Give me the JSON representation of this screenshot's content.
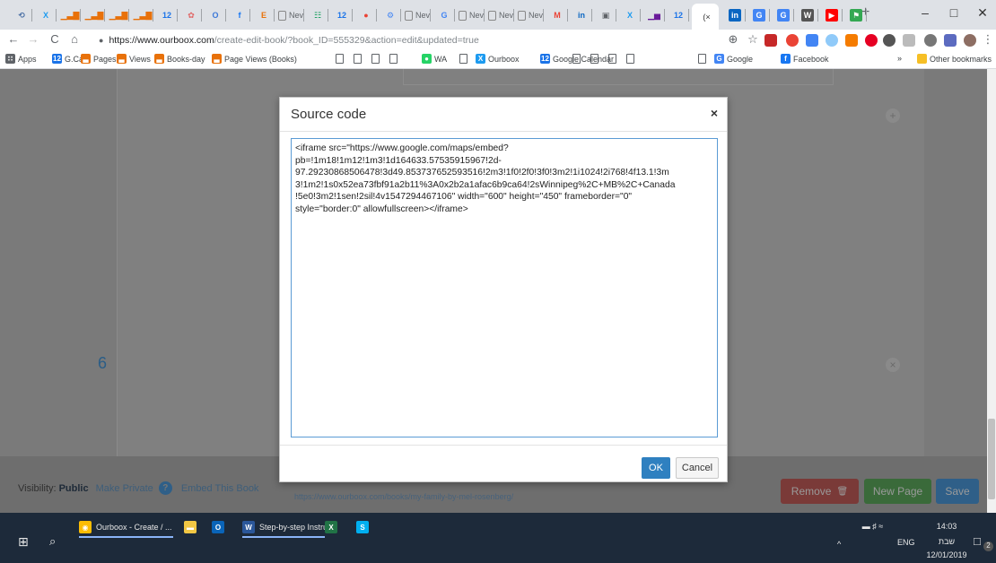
{
  "browser": {
    "tabs": [
      {
        "icon": "refresh-tab-icon",
        "glyph": "⟲",
        "color": "#4a6fa5"
      },
      {
        "icon": "x-tab-icon",
        "glyph": "X",
        "color": "#1d9bf0"
      },
      {
        "icon": "analytics-tab-icon",
        "glyph": "▁▃▇",
        "color": "#e8710a"
      },
      {
        "icon": "analytics-tab-icon",
        "glyph": "▁▃▇",
        "color": "#e8710a"
      },
      {
        "icon": "analytics-tab-icon",
        "glyph": "▁▃▇",
        "color": "#e8710a"
      },
      {
        "icon": "analytics-tab-icon",
        "glyph": "▁▃▇",
        "color": "#e8710a"
      },
      {
        "icon": "calendar-tab-icon",
        "glyph": "12",
        "color": "#1a73e8"
      },
      {
        "icon": "flower-tab-icon",
        "glyph": "✿",
        "color": "#e06666"
      },
      {
        "icon": "o-tab-icon",
        "glyph": "O",
        "color": "#3c78d8"
      },
      {
        "icon": "facebook-tab-icon",
        "glyph": "f",
        "color": "#1877f2"
      },
      {
        "icon": "e-tab-icon",
        "glyph": "E",
        "color": "#e8710a"
      },
      {
        "icon": "page-tab-icon",
        "glyph": "",
        "color": "#888",
        "label": "Nev"
      },
      {
        "icon": "table-tab-icon",
        "glyph": "☷",
        "color": "#0f9d58"
      },
      {
        "icon": "calendar-tab-icon",
        "glyph": "12",
        "color": "#1a73e8"
      },
      {
        "icon": "red-circle-tab-icon",
        "glyph": "●",
        "color": "#ea4335"
      },
      {
        "icon": "settings-tab-icon",
        "glyph": "⚙",
        "color": "#4285f4"
      },
      {
        "icon": "page-tab-icon",
        "glyph": "",
        "color": "#888",
        "label": "Nev"
      },
      {
        "icon": "google-tab-icon",
        "glyph": "G",
        "color": "#4285f4"
      },
      {
        "icon": "page-tab-icon",
        "glyph": "",
        "color": "#888",
        "label": "Nev"
      },
      {
        "icon": "page-tab-icon",
        "glyph": "",
        "color": "#888",
        "label": "Nev"
      },
      {
        "icon": "page-tab-icon",
        "glyph": "",
        "color": "#888",
        "label": "Nev"
      },
      {
        "icon": "gmail-tab-icon",
        "glyph": "M",
        "color": "#ea4335"
      },
      {
        "icon": "linkedin-tab-icon",
        "glyph": "in",
        "color": "#0a66c2"
      },
      {
        "icon": "window-tab-icon",
        "glyph": "▣",
        "color": "#5f6368"
      },
      {
        "icon": "x-tab-icon",
        "glyph": "X",
        "color": "#1d9bf0"
      },
      {
        "icon": "stats-tab-icon",
        "glyph": "▁▅",
        "color": "#6a1b9a"
      },
      {
        "icon": "calendar-tab-icon",
        "glyph": "12",
        "color": "#1a73e8"
      }
    ],
    "active_tab_label": "(×",
    "right_tabs": [
      {
        "icon": "linkedin-tab-icon",
        "glyph": "in",
        "color": "#0a66c2"
      },
      {
        "icon": "google-tab-icon",
        "glyph": "G",
        "color": "#4285f4"
      },
      {
        "icon": "google-tab-icon",
        "glyph": "G",
        "color": "#4285f4"
      },
      {
        "icon": "wikipedia-tab-icon",
        "glyph": "W",
        "color": "#555"
      },
      {
        "icon": "youtube-tab-icon",
        "glyph": "▶",
        "color": "#ff0000"
      },
      {
        "icon": "maps-tab-icon",
        "glyph": "⚑",
        "color": "#34a853"
      }
    ],
    "new_tab": "+",
    "minimize": "–",
    "maximize": "□",
    "close": "✕",
    "url_host": "https://www.ourboox.com",
    "url_path": "/create-edit-book/?book_ID=555329&action=edit&updated=true",
    "back": "←",
    "forward": "→",
    "reload": "C",
    "home": "⌂",
    "lock": "🔒",
    "zoom": "⊕",
    "star": "☆",
    "menu": "⋮",
    "bookmarks": [
      {
        "label": "Apps",
        "icon": "apps-icon",
        "color": "#5f6368",
        "glyph": "∷"
      },
      {
        "label": "G.Cal",
        "icon": "calendar-icon",
        "color": "#1a73e8",
        "glyph": "12"
      },
      {
        "label": "Pages",
        "icon": "analytics-icon",
        "color": "#e8710a",
        "glyph": "▃"
      },
      {
        "label": "Views",
        "icon": "analytics-icon",
        "color": "#e8710a",
        "glyph": "▃"
      },
      {
        "label": "Books-day",
        "icon": "analytics-icon",
        "color": "#e8710a",
        "glyph": "▃"
      },
      {
        "label": "Page Views (Books)",
        "icon": "analytics-icon",
        "color": "#e8710a",
        "glyph": "▃"
      },
      {
        "label": "WA",
        "icon": "whatsapp-icon",
        "color": "#25d366",
        "glyph": "●"
      },
      {
        "label": "Ourboox",
        "icon": "x-icon",
        "color": "#1d9bf0",
        "glyph": "X"
      },
      {
        "label": "Google Calendar",
        "icon": "calendar-icon",
        "color": "#1a73e8",
        "glyph": "12"
      },
      {
        "label": "Google",
        "icon": "google-icon",
        "color": "#4285f4",
        "glyph": "G"
      },
      {
        "label": "Facebook",
        "icon": "facebook-icon",
        "color": "#1877f2",
        "glyph": "f"
      }
    ],
    "bookmarks_more": "»",
    "other_bookmarks": "Other bookmarks"
  },
  "page": {
    "page_number": "6",
    "visibility_label": "Visibility:",
    "visibility_value": "Public",
    "make_private": "Make Private",
    "help": "?",
    "embed_book": "Embed This Book",
    "book_link": "https://www.ourboox.com/books/my-family-by-mel-rosenberg/",
    "remove": "Remove",
    "trash": "🗑",
    "new_page": "New Page",
    "save": "Save",
    "plus": "+",
    "times": "×"
  },
  "modal": {
    "title": "Source code",
    "close": "×",
    "code": "<iframe src=\"https://www.google.com/maps/embed?\npb=!1m18!1m12!1m3!1d164633.57535915967!2d-\n97.29230868506478!3d49.853737652593516!2m3!1f0!2f0!3f0!3m2!1i1024!2i768!4f13.1!3m\n3!1m2!1s0x52ea73fbf91a2b11%3A0x2b2a1afac6b9ca64!2sWinnipeg%2C+MB%2C+Canada\n!5e0!3m2!1sen!2sil!4v1547294467106\" width=\"600\" height=\"450\" frameborder=\"0\"\nstyle=\"border:0\" allowfullscreen></iframe>",
    "ok": "OK",
    "cancel": "Cancel"
  },
  "taskbar": {
    "start": "⊞",
    "search": "⌕",
    "items": [
      {
        "label": "Ourboox - Create / ...",
        "icon": "chrome-icon",
        "color": "#fbbc04",
        "glyph": "◉"
      },
      {
        "label": "",
        "icon": "file-explorer-icon",
        "color": "#f2c744",
        "glyph": "▬"
      },
      {
        "label": "",
        "icon": "outlook-icon",
        "color": "#0a64b8",
        "glyph": "O"
      },
      {
        "label": "Step-by-step Instru...",
        "icon": "word-icon",
        "color": "#2b579a",
        "glyph": "W"
      },
      {
        "label": "",
        "icon": "excel-icon",
        "color": "#217346",
        "glyph": "X"
      },
      {
        "label": "",
        "icon": "skype-icon",
        "color": "#00aff0",
        "glyph": "S"
      }
    ],
    "lang": "ENG",
    "time": "14:03",
    "day": "שבת",
    "date": "12/01/2019",
    "notif_count": "2",
    "caret": "^"
  }
}
